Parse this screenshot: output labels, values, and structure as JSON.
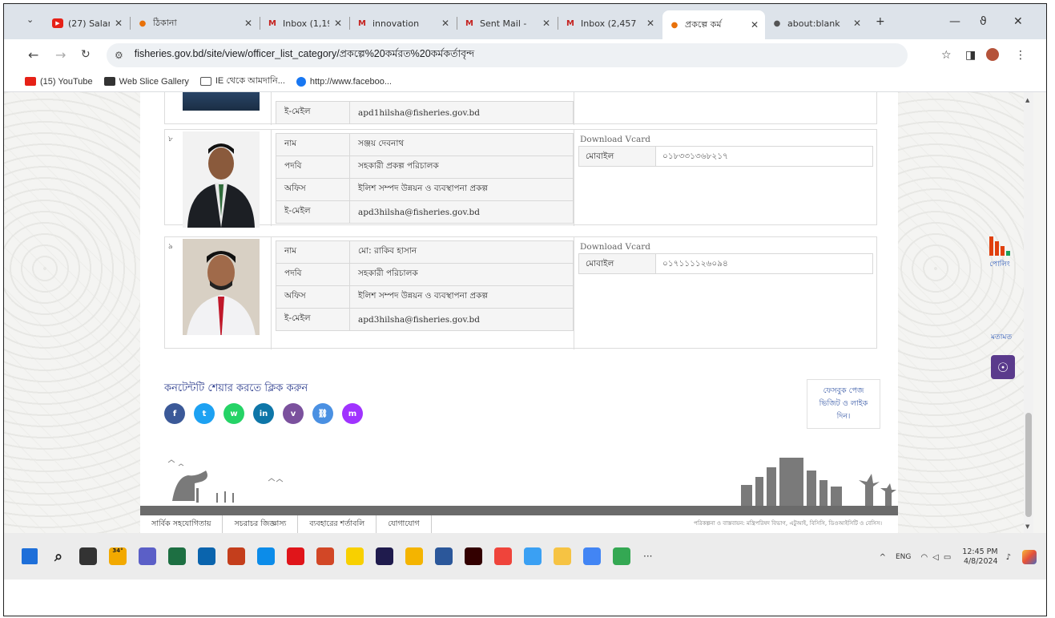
{
  "browser": {
    "tabs": [
      {
        "label": "(27) Salam F",
        "icon": "youtube-icon",
        "color": "#e62117"
      },
      {
        "label": "ঠিকানা",
        "icon": "site-favicon-icon",
        "color": "#e8710a"
      },
      {
        "label": "Inbox (1,199",
        "icon": "gmail-icon",
        "color": "#c5221f"
      },
      {
        "label": "innovation",
        "icon": "gmail-icon",
        "color": "#c5221f"
      },
      {
        "label": "Sent Mail -",
        "icon": "gmail-icon",
        "color": "#c5221f"
      },
      {
        "label": "Inbox (2,457",
        "icon": "gmail-icon",
        "color": "#c5221f"
      },
      {
        "label": "প্রকল্পে কর্ম",
        "icon": "site-favicon-icon",
        "color": "#e8710a"
      },
      {
        "label": "about:blank",
        "icon": "globe-icon",
        "color": "#555555"
      }
    ],
    "url": "fisheries.gov.bd/site/view/officer_list_category/প্রকল্পে%20কর্মরত%20কর্মকর্তাবৃন্দ",
    "bookmarks": [
      {
        "label": "(15) YouTube",
        "color": "#e62117"
      },
      {
        "label": "Web Slice Gallery",
        "color": "#333333"
      },
      {
        "label": "IE থেকে আমদানি...",
        "color": "#555555"
      },
      {
        "label": "http://www.faceboo...",
        "color": "#1877f2"
      }
    ]
  },
  "page": {
    "top_card": {
      "email_label": "ই-মেইল",
      "email": "apd1hilsha@fisheries.gov.bd"
    },
    "officers": [
      {
        "serial": "৮",
        "fields": [
          {
            "k": "নাম",
            "v": "সঞ্জয় দেবনাথ"
          },
          {
            "k": "পদবি",
            "v": "সহকারী প্রকল্প পরিচালক"
          },
          {
            "k": "অফিস",
            "v": "ইলিশ সম্পদ উন্নয়ন ও ব্যবস্থাপনা প্রকল্প"
          },
          {
            "k": "ই-মেইল",
            "v": "apd3hilsha@fisheries.gov.bd"
          }
        ],
        "vcard_label": "Download Vcard",
        "mobile_label": "মোবাইল",
        "mobile": "০১৮৩৩১৩৬৮২১৭"
      },
      {
        "serial": "৯",
        "fields": [
          {
            "k": "নাম",
            "v": "মো: রাকিব হাসান"
          },
          {
            "k": "পদবি",
            "v": "সহকারী পরিচালক"
          },
          {
            "k": "অফিস",
            "v": "ইলিশ সম্পদ উন্নয়ন ও ব্যবস্থাপনা প্রকল্প"
          },
          {
            "k": "ই-মেইল",
            "v": "apd3hilsha@fisheries.gov.bd"
          }
        ],
        "vcard_label": "Download Vcard",
        "mobile_label": "মোবাইল",
        "mobile": "০১৭১১১১২৬০৯৪"
      }
    ],
    "share_title": "কনটেন্টটি শেয়ার করতে ক্লিক করুন",
    "share_buttons": [
      {
        "icon": "facebook-icon",
        "glyph": "f",
        "color": "#3b5998"
      },
      {
        "icon": "twitter-icon",
        "glyph": "t",
        "color": "#1da1f2"
      },
      {
        "icon": "whatsapp-icon",
        "glyph": "w",
        "color": "#25d366"
      },
      {
        "icon": "linkedin-icon",
        "glyph": "in",
        "color": "#0e76a8"
      },
      {
        "icon": "viber-icon",
        "glyph": "v",
        "color": "#7b519d"
      },
      {
        "icon": "copy-link-icon",
        "glyph": "⛓",
        "color": "#4a90e2"
      },
      {
        "icon": "messenger-icon",
        "glyph": "m",
        "color": "#a033ff"
      }
    ],
    "fb_box": [
      "ফেসবুক পেজ",
      "ভিজিট ও লাইক",
      "দিন।"
    ],
    "footer_links": [
      "সার্বিক সহযোগিতায়",
      "সচরাচর জিজ্ঞাস্য",
      "ব্যবহারের শর্তাবলি",
      "যোগাযোগ"
    ],
    "footer_copy": "পরিকল্পনা ও বাস্তবায়ন: মন্ত্রিপরিষদ বিভাগ, এটুআই, বিসিসি, ডিওআইসিটি ও বেসিস।",
    "side_poll": "পোলিং",
    "side_feedback": "মতামত"
  },
  "taskbar": {
    "weather": "34°",
    "lang": "ENG",
    "time": "12:45 PM",
    "date": "4/8/2024",
    "apps": [
      {
        "icon": "windows-start-icon",
        "color": "#1e6fd9"
      },
      {
        "icon": "search-icon",
        "color": "#ececec"
      },
      {
        "icon": "task-view-icon",
        "color": "#333333"
      },
      {
        "icon": "weather-icon",
        "color": "#f2a900"
      },
      {
        "icon": "teams-icon",
        "color": "#5b5fc7"
      },
      {
        "icon": "excel-icon",
        "color": "#1d6f42"
      },
      {
        "icon": "mail-icon",
        "color": "#0a64ad"
      },
      {
        "icon": "photo-icon",
        "color": "#c43e1c"
      },
      {
        "icon": "edge-icon",
        "color": "#0c8ce9"
      },
      {
        "icon": "opera-icon",
        "color": "#e0151a"
      },
      {
        "icon": "powerpoint-icon",
        "color": "#d24726"
      },
      {
        "icon": "sticky-notes-icon",
        "color": "#f8d000"
      },
      {
        "icon": "premiere-icon",
        "color": "#1f1b4d"
      },
      {
        "icon": "file-icon",
        "color": "#f4b400"
      },
      {
        "icon": "word-icon",
        "color": "#2b579a"
      },
      {
        "icon": "illustrator-icon",
        "color": "#330000"
      },
      {
        "icon": "anydesk-icon",
        "color": "#ef443b"
      },
      {
        "icon": "snip-icon",
        "color": "#3aa0f3"
      },
      {
        "icon": "explorer-icon",
        "color": "#f6c343"
      },
      {
        "icon": "chrome-icon",
        "color": "#4285f4"
      },
      {
        "icon": "chrome-profile-icon",
        "color": "#34a853"
      }
    ]
  }
}
